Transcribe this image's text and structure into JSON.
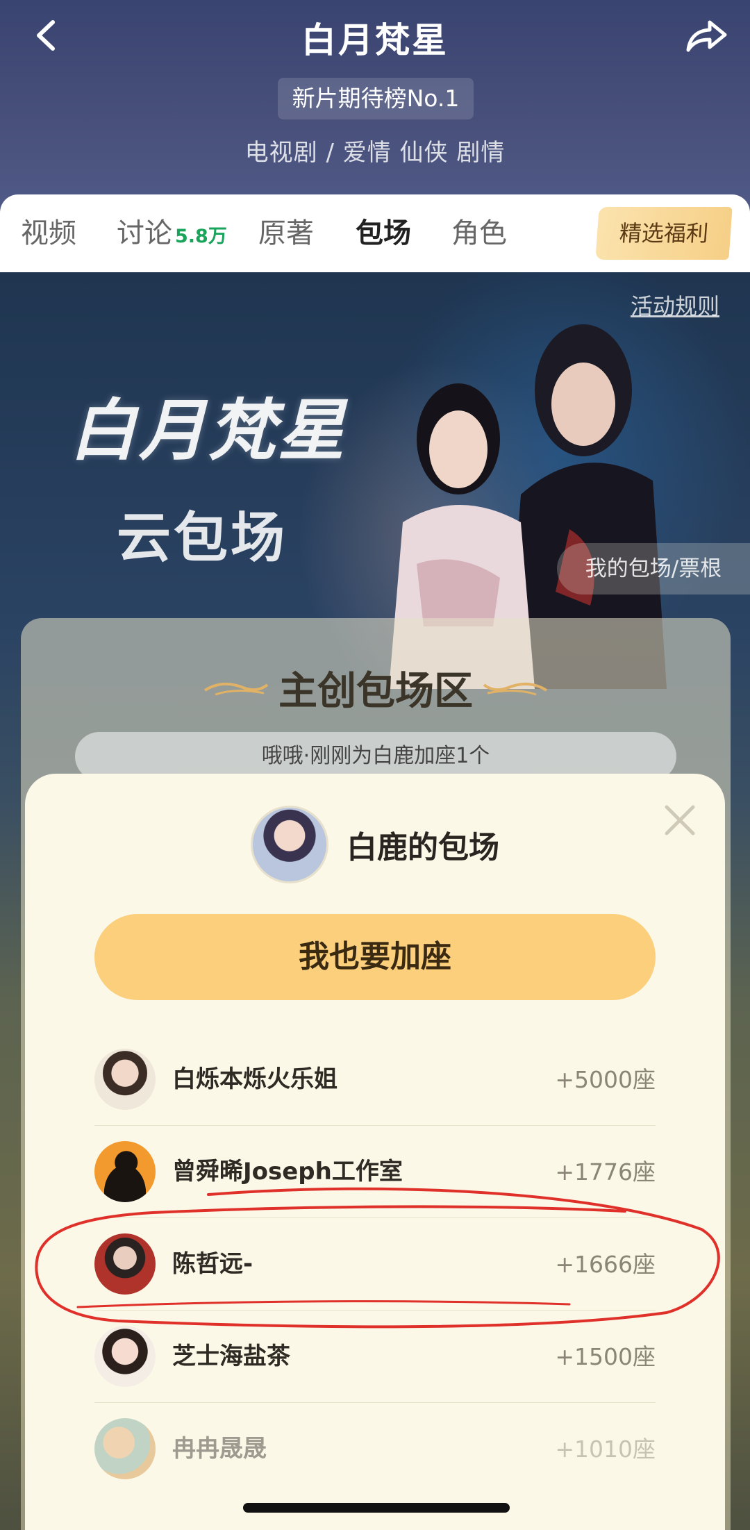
{
  "header": {
    "title": "白月梵星",
    "rank_badge": "新片期待榜No.1",
    "genres": "电视剧 / 爱情 仙侠 剧情"
  },
  "tabs": [
    {
      "label": "视频",
      "count": ""
    },
    {
      "label": "讨论",
      "count": "5.8万"
    },
    {
      "label": "原著",
      "count": ""
    },
    {
      "label": "包场",
      "count": "",
      "active": true
    },
    {
      "label": "角色",
      "count": ""
    }
  ],
  "welfare_button": "精选福利",
  "poster": {
    "rules_link": "活动规则",
    "logo_text": "白月梵星",
    "subtitle": "云包场",
    "my_booth": "我的包场/票根"
  },
  "creator_area": {
    "title": "主创包场区",
    "ticker": "哦哦·刚刚为白鹿加座1个"
  },
  "modal": {
    "title": "白鹿的包场",
    "join_button": "我也要加座",
    "rows": [
      {
        "name": "白烁本烁火乐姐",
        "seats": "+5000座"
      },
      {
        "name": "曾舜晞Joseph工作室",
        "seats": "+1776座"
      },
      {
        "name": "陈哲远-",
        "seats": "+1666座"
      },
      {
        "name": "芝士海盐茶",
        "seats": "+1500座"
      },
      {
        "name": "冉冉晟晟",
        "seats": "+1010座"
      }
    ]
  },
  "colors": {
    "accent_green": "#19a35b",
    "join_button": "#fbcf7c",
    "modal_bg": "#fbf8e8",
    "annotation_red": "#e0302a"
  }
}
